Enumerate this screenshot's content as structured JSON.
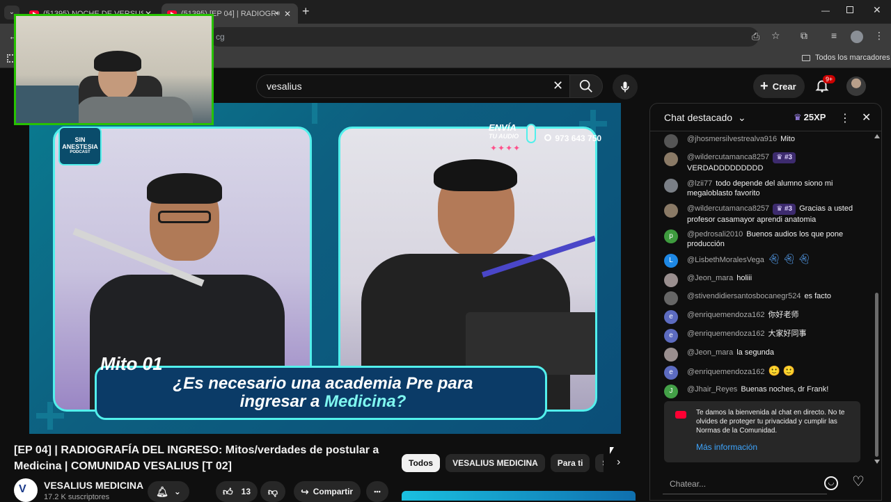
{
  "browser": {
    "tabs": [
      {
        "title": "(51395) NOCHE DE VERSUS EN..."
      },
      {
        "title": "(51395) [EP 04] | RADIOGRA..."
      }
    ],
    "url": "cg",
    "bookmarks_label": "Todos los marcadores",
    "new_tab": "+"
  },
  "youtube": {
    "search_value": "vesalius",
    "create_label": "Crear",
    "notifications_count": "9+"
  },
  "video": {
    "badge_line1": "SIN",
    "badge_line2": "ANESTESIA",
    "badge_line3": "PODCAST",
    "envia_line1": "ENVÍA",
    "envia_line2": "TU AUDIO",
    "phone": "973 643 750",
    "mito_label": "Mito 01",
    "caption_line1": "¿Es necesario una academia Pre para",
    "caption_line2_a": "ingresar a ",
    "caption_line2_b": "Medicina?"
  },
  "meta": {
    "title": "[EP 04] | RADIOGRAFÍA DEL INGRESO: Mitos/verdades de postular a Medicina | COMUNIDAD VESALIUS [T 02]",
    "channel_name": "VESALIUS MEDICINA",
    "subscribers": "17.2 K suscriptores",
    "likes": "13",
    "share_label": "Compartir",
    "more": "•••"
  },
  "chips": [
    "Todos",
    "VESALIUS MEDICINA",
    "Para ti",
    "Subi"
  ],
  "chat": {
    "title": "Chat destacado",
    "xp": "25XP",
    "messages": [
      {
        "user": "@jhosmersilvestrealva916",
        "badge": "",
        "text": "Mito",
        "avatar": "",
        "color": "#555555"
      },
      {
        "user": "@wildercutamanca8257",
        "badge": "#3",
        "text": "VERDADDDDDDDDD",
        "avatar": "",
        "color": "#8a7a66"
      },
      {
        "user": "@lzii77",
        "badge": "",
        "text": "todo depende del alumno siono mi megaloblasto favorito",
        "avatar": "",
        "color": "#7a7f86"
      },
      {
        "user": "@wildercutamanca8257",
        "badge": "#3",
        "text": "Gracias a usted profesor casamayor aprendi anatomia",
        "avatar": "",
        "color": "#8a7a66"
      },
      {
        "user": "@pedrosali2010",
        "badge": "",
        "text": "Buenos audios los que pone producción",
        "avatar": "p",
        "color": "#3e9b3e"
      },
      {
        "user": "@LisbethMoralesVega",
        "badge": "",
        "text": "",
        "avatar": "L",
        "color": "#1e88e5"
      },
      {
        "user": "@Jeon_mara",
        "badge": "",
        "text": "holiii",
        "avatar": "",
        "color": "#9a8f8f"
      },
      {
        "user": "@stivendidiersantosbocanegr524",
        "badge": "",
        "text": "es facto",
        "avatar": "",
        "color": "#666666"
      },
      {
        "user": "@enriquemendoza162",
        "badge": "",
        "text": "你好老师",
        "avatar": "e",
        "color": "#5c6bc0"
      },
      {
        "user": "@enriquemendoza162",
        "badge": "",
        "text": "大家好同事",
        "avatar": "e",
        "color": "#5c6bc0"
      },
      {
        "user": "@Jeon_mara",
        "badge": "",
        "text": "la segunda",
        "avatar": "",
        "color": "#9a8f8f"
      },
      {
        "user": "@enriquemendoza162",
        "badge": "",
        "text": "🙂 🙂",
        "avatar": "e",
        "color": "#5c6bc0"
      },
      {
        "user": "@Jhair_Reyes",
        "badge": "",
        "text": "Buenas noches, dr Frank!",
        "avatar": "J",
        "color": "#43a047"
      }
    ],
    "welcome_text": "Te damos la bienvenida al chat en directo. No te olvides de proteger tu privacidad y cumplir las Normas de la Comunidad.",
    "more_info": "Más información",
    "input_placeholder": "Chatear..."
  }
}
